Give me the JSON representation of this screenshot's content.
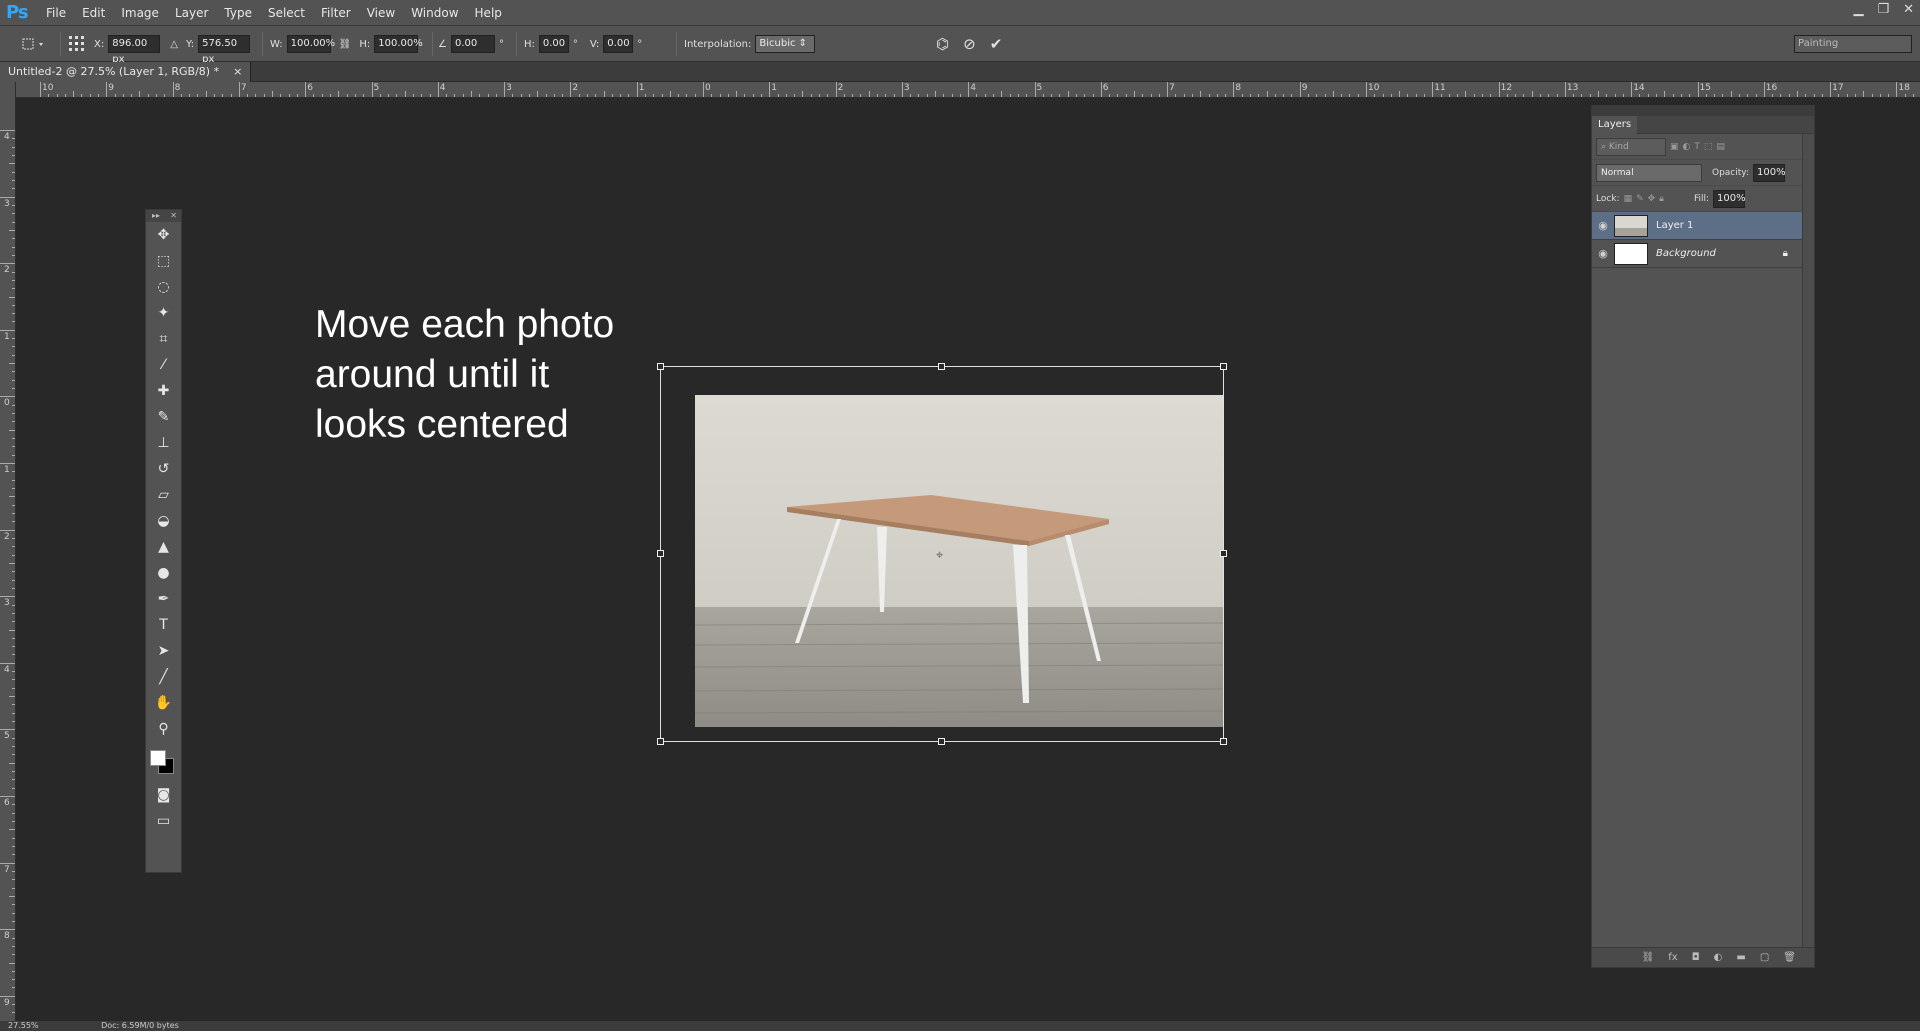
{
  "app": {
    "logo": "Ps"
  },
  "menu": [
    "File",
    "Edit",
    "Image",
    "Layer",
    "Type",
    "Select",
    "Filter",
    "View",
    "Window",
    "Help"
  ],
  "window_controls": {
    "minimize": "▁",
    "restore": "❐",
    "close": "✕"
  },
  "options": {
    "x_label": "X:",
    "x_value": "896.00 px",
    "y_label": "Y:",
    "y_value": "576.50 px",
    "w_label": "W:",
    "w_value": "100.00%",
    "h_label": "H:",
    "h_value": "100.00%",
    "angle_value": "0.00",
    "deg": "°",
    "hskew_label": "H:",
    "hskew_value": "0.00",
    "vskew_label": "V:",
    "vskew_value": "0.00",
    "interp_label": "Interpolation:",
    "interp_value": "Bicubic",
    "workspace": "Painting"
  },
  "document_tab": {
    "title": "Untitled-2 @ 27.5% (Layer 1, RGB/8) *",
    "close": "×"
  },
  "ruler_top": [
    "10",
    "9",
    "8",
    "7",
    "6",
    "5",
    "4",
    "3",
    "2",
    "1",
    "0",
    "1",
    "2",
    "3",
    "4",
    "5",
    "6",
    "7",
    "8",
    "9",
    "10",
    "11",
    "12",
    "13",
    "14",
    "15",
    "16",
    "17",
    "18"
  ],
  "ruler_left": [
    "4",
    "3",
    "2",
    "1",
    "0",
    "1",
    "2",
    "3",
    "4",
    "5",
    "6",
    "7",
    "8",
    "9"
  ],
  "canvas": {
    "instruction": "Move each photo\naround until it\nlooks centered"
  },
  "tools": [
    "move-tool-icon",
    "marquee-icon",
    "lasso-icon",
    "magic-wand-icon",
    "crop-icon",
    "eyedropper-icon",
    "healing-brush-icon",
    "brush-icon",
    "clone-stamp-icon",
    "history-brush-icon",
    "eraser-icon",
    "paint-bucket-icon",
    "blur-icon",
    "dodge-icon",
    "pen-icon",
    "type-icon",
    "path-select-icon",
    "line-icon",
    "hand-icon",
    "zoom-icon"
  ],
  "layers_panel": {
    "title": "Layers",
    "kind": "Kind",
    "blend": "Normal",
    "opacity_label": "Opacity:",
    "opacity_value": "100%",
    "lock_label": "Lock:",
    "fill_label": "Fill:",
    "fill_value": "100%",
    "layers": [
      {
        "name": "Layer 1"
      },
      {
        "name": "Background"
      }
    ]
  },
  "status": {
    "zoom": "27.55%",
    "doc": "Doc: 6.59M/0 bytes"
  }
}
